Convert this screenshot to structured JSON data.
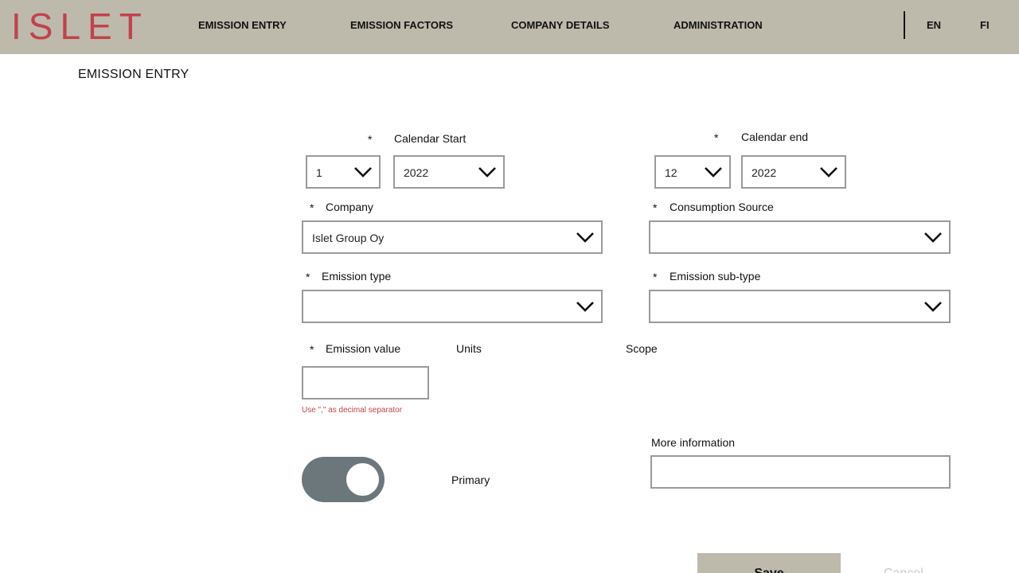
{
  "header": {
    "logo_text": "ISLET",
    "nav": [
      "EMISSION ENTRY",
      "EMISSION FACTORS",
      "COMPANY DETAILS",
      "ADMINISTRATION"
    ],
    "languages": [
      "EN",
      "FI"
    ],
    "brand_color": "#c2424b",
    "bar_color": "#bdbaac"
  },
  "page": {
    "title": "EMISSION ENTRY"
  },
  "form": {
    "required_mark": "*",
    "calendar_start": {
      "label": "Calendar Start",
      "month": "1",
      "year": "2022"
    },
    "calendar_end": {
      "label": "Calendar end",
      "month": "12",
      "year": "2022"
    },
    "company": {
      "label": "Company",
      "value": "Islet Group Oy"
    },
    "consumption_source": {
      "label": "Consumption Source",
      "value": ""
    },
    "emission_type": {
      "label": "Emission type",
      "value": ""
    },
    "emission_subtype": {
      "label": "Emission sub-type",
      "value": ""
    },
    "emission_value": {
      "label": "Emission value",
      "value": "",
      "hint": "Use \",\" as decimal separator"
    },
    "units": {
      "label": "Units"
    },
    "scope": {
      "label": "Scope"
    },
    "primary": {
      "label": "Primary",
      "on": true
    },
    "more_information": {
      "label": "More information",
      "value": ""
    }
  },
  "actions": {
    "save_label": "Save",
    "cancel_label": "Cancel"
  },
  "icons": {
    "dropdown": "chevron-down-icon"
  }
}
